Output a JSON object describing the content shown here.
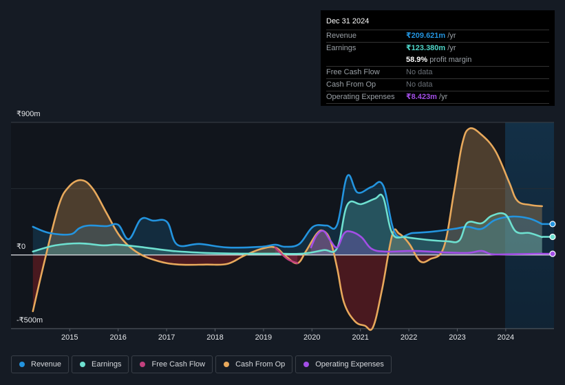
{
  "tooltip": {
    "date": "Dec 31 2024",
    "rows": [
      {
        "label": "Revenue",
        "value": "₹209.621m",
        "unit": " /yr",
        "color": "#2394df"
      },
      {
        "label": "Earnings",
        "value": "₹123.380m",
        "unit": " /yr",
        "color": "#4fd6c9"
      },
      {
        "label": "",
        "value": "58.9%",
        "unit": " profit margin",
        "color": "#ffffff"
      },
      {
        "label": "Free Cash Flow",
        "value": "No data",
        "unit": "",
        "color": "#6b7178"
      },
      {
        "label": "Cash From Op",
        "value": "No data",
        "unit": "",
        "color": "#6b7178"
      },
      {
        "label": "Operating Expenses",
        "value": "₹8.423m",
        "unit": " /yr",
        "color": "#a24ee6"
      }
    ]
  },
  "legend": [
    {
      "label": "Revenue",
      "color": "#2394df"
    },
    {
      "label": "Earnings",
      "color": "#6ee0d0"
    },
    {
      "label": "Free Cash Flow",
      "color": "#c2417e"
    },
    {
      "label": "Cash From Op",
      "color": "#e8a95c"
    },
    {
      "label": "Operating Expenses",
      "color": "#a24ee6"
    }
  ],
  "chart_data": {
    "type": "area",
    "title": "",
    "xlabel": "",
    "ylabel": "",
    "currency": "INR",
    "units": "millions",
    "ylim": [
      -500,
      900
    ],
    "y_tick_labels": [
      {
        "value": 900,
        "label": "₹900m"
      },
      {
        "value": 0,
        "label": "₹0"
      },
      {
        "value": -500,
        "label": "-₹500m"
      }
    ],
    "xlim": [
      2014.0,
      2025.0
    ],
    "x_tick_labels": [
      "2015",
      "2016",
      "2017",
      "2018",
      "2019",
      "2020",
      "2021",
      "2022",
      "2023",
      "2024"
    ],
    "x_ticks": [
      2015,
      2016,
      2017,
      2018,
      2019,
      2020,
      2021,
      2022,
      2023,
      2024
    ],
    "forecast_region_start": 2024.0,
    "grid": true,
    "legend_position": "bottom",
    "series": [
      {
        "name": "Cash From Op",
        "color": "#e8a95c",
        "x": [
          2014.24,
          2014.48,
          2014.77,
          2014.98,
          2015.24,
          2015.48,
          2015.76,
          2016.05,
          2016.41,
          2016.83,
          2017.25,
          2017.82,
          2018.25,
          2018.6,
          2018.96,
          2019.24,
          2019.46,
          2019.7,
          2019.88,
          2020.1,
          2020.24,
          2020.38,
          2020.52,
          2020.66,
          2020.88,
          2021.09,
          2021.26,
          2021.45,
          2021.66,
          2021.8,
          2022.01,
          2022.23,
          2022.44,
          2022.72,
          2022.93,
          2023.1,
          2023.25,
          2023.5,
          2023.79,
          2024.07,
          2024.24,
          2024.5,
          2024.75
        ],
        "values": [
          -382,
          -42,
          331,
          462,
          508,
          448,
          285,
          121,
          14,
          -42,
          -65,
          -65,
          -61,
          -5,
          42,
          51,
          -9,
          -56,
          28,
          145,
          163,
          98,
          -89,
          -322,
          -448,
          -480,
          -490,
          -229,
          140,
          145,
          75,
          -42,
          -28,
          51,
          424,
          751,
          858,
          816,
          704,
          494,
          368,
          340,
          331
        ]
      },
      {
        "name": "Revenue",
        "color": "#2394df",
        "x": [
          2014.24,
          2014.58,
          2015.01,
          2015.2,
          2015.4,
          2015.76,
          2016.0,
          2016.22,
          2016.47,
          2016.72,
          2017.01,
          2017.22,
          2017.68,
          2018.25,
          2018.96,
          2019.24,
          2019.45,
          2019.74,
          2020.02,
          2020.3,
          2020.52,
          2020.73,
          2020.94,
          2021.23,
          2021.47,
          2021.72,
          2022.08,
          2022.5,
          2022.93,
          2023.21,
          2023.5,
          2023.78,
          2024.14,
          2024.49,
          2024.75
        ],
        "values": [
          191,
          149,
          140,
          182,
          200,
          196,
          205,
          107,
          243,
          233,
          224,
          70,
          75,
          51,
          56,
          70,
          56,
          75,
          191,
          200,
          205,
          536,
          424,
          462,
          471,
          145,
          149,
          159,
          177,
          191,
          177,
          238,
          261,
          247,
          210
        ]
      },
      {
        "name": "Earnings",
        "color": "#6ee0d0",
        "x": [
          2014.24,
          2014.7,
          2015.2,
          2015.69,
          2016.0,
          2016.54,
          2017.11,
          2017.82,
          2018.53,
          2019.24,
          2019.81,
          2020.24,
          2020.52,
          2020.73,
          2021.02,
          2021.3,
          2021.47,
          2021.66,
          2021.94,
          2022.37,
          2022.79,
          2023.04,
          2023.21,
          2023.5,
          2023.71,
          2023.99,
          2024.21,
          2024.49,
          2024.75
        ],
        "values": [
          23,
          65,
          79,
          65,
          70,
          51,
          28,
          14,
          9,
          9,
          9,
          33,
          47,
          340,
          345,
          382,
          392,
          145,
          121,
          103,
          93,
          98,
          219,
          215,
          266,
          275,
          159,
          149,
          121
        ]
      },
      {
        "name": "Free Cash Flow",
        "color": "#c2417e",
        "x": [
          2019.24,
          2019.38,
          2019.52,
          2019.7
        ],
        "values": [
          51,
          5,
          -33,
          -56
        ]
      },
      {
        "name": "Operating Expenses",
        "color": "#a24ee6",
        "x": [
          2019.98,
          2020.1,
          2020.24,
          2020.38,
          2020.52,
          2020.66,
          2020.8,
          2021.02,
          2021.23,
          2021.52,
          2022.08,
          2022.65,
          2023.21,
          2023.5,
          2023.71,
          2024.07,
          2024.75
        ],
        "values": [
          51,
          135,
          163,
          98,
          51,
          145,
          159,
          121,
          42,
          23,
          28,
          19,
          14,
          28,
          5,
          5,
          9
        ]
      }
    ],
    "end_markers": [
      {
        "series": "Revenue",
        "value": 210,
        "color": "#2394df"
      },
      {
        "series": "Earnings",
        "value": 123,
        "color": "#6ee0d0"
      },
      {
        "series": "Operating Expenses",
        "value": 8,
        "color": "#a24ee6"
      }
    ]
  }
}
